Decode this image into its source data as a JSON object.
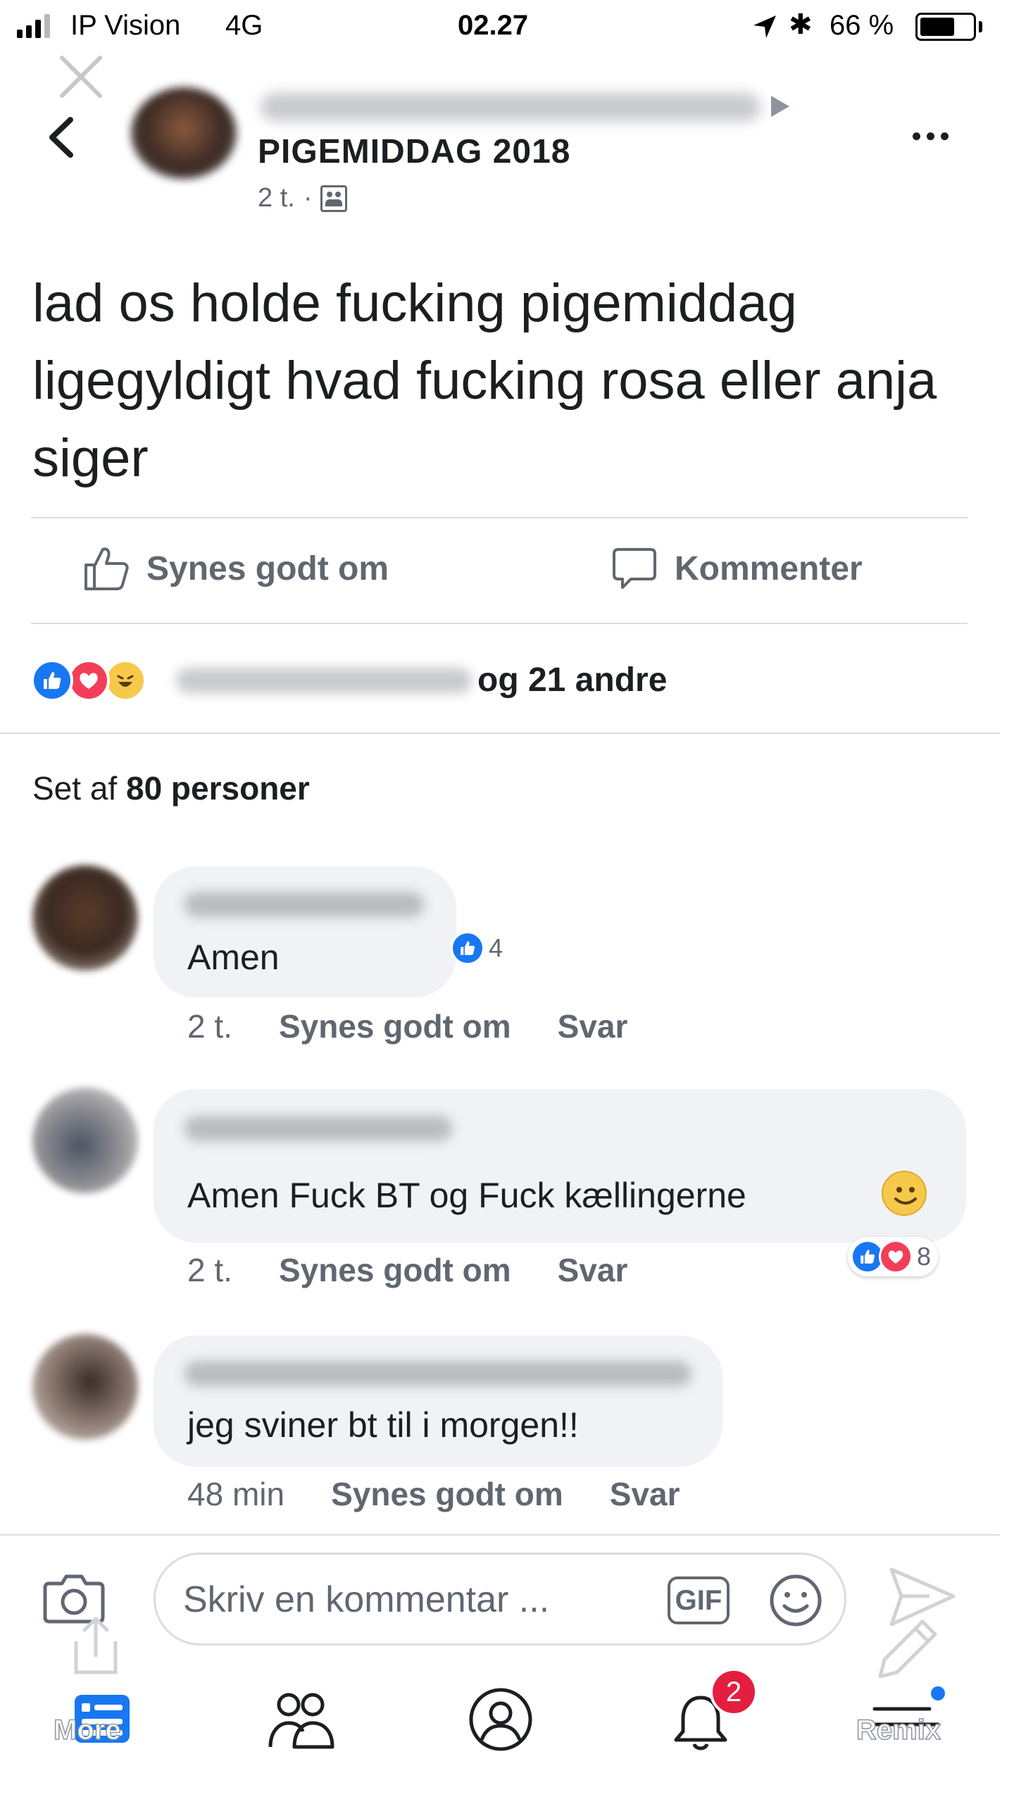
{
  "status_bar": {
    "carrier": "IP Vision",
    "network": "4G",
    "time": "02.27",
    "battery": "66 %",
    "battery_level": 0.66
  },
  "post": {
    "group_name": "PIGEMIDDAG 2018",
    "time": "2 t.",
    "separator": "·",
    "text": "lad os holde fucking pigemiddag ligegyldigt hvad fucking rosa eller anja siger",
    "actions": {
      "like": "Synes godt om",
      "comment": "Kommenter"
    },
    "reactions_text": "og 21 andre",
    "seen_prefix": "Set af",
    "seen_count": "80 personer"
  },
  "comments": [
    {
      "text": "Amen",
      "time": "2 t.",
      "like": "Synes godt om",
      "reply": "Svar",
      "reaction_count": "4"
    },
    {
      "text": "Amen Fuck BT og Fuck kællingerne",
      "time": "2 t.",
      "like": "Synes godt om",
      "reply": "Svar",
      "reaction_count": "8"
    },
    {
      "text": "jeg sviner bt til i morgen!!",
      "time": "48 min",
      "like": "Synes godt om",
      "reply": "Svar"
    }
  ],
  "composer": {
    "placeholder": "Skriv en kommentar ...",
    "gif": "GIF"
  },
  "tab_bar": {
    "notifications_badge": "2",
    "more_label": "More",
    "remix_label": "Remix"
  },
  "icons": [
    "close-icon",
    "back-icon",
    "more-icon",
    "group-icon",
    "like-icon",
    "comment-icon",
    "camera-icon",
    "gif-icon",
    "emoji-icon",
    "send-icon",
    "share-icon",
    "pencil-icon",
    "news-feed-icon",
    "friends-icon",
    "profile-icon",
    "notifications-icon",
    "menu-icon"
  ],
  "colors": {
    "like_blue": "#1877f2",
    "love_red": "#f33e58",
    "haha_yellow": "#f7c94a",
    "text_primary": "#1c1e21",
    "text_secondary": "#606770",
    "bubble": "#f0f2f5",
    "badge_red": "#e41e3f"
  }
}
